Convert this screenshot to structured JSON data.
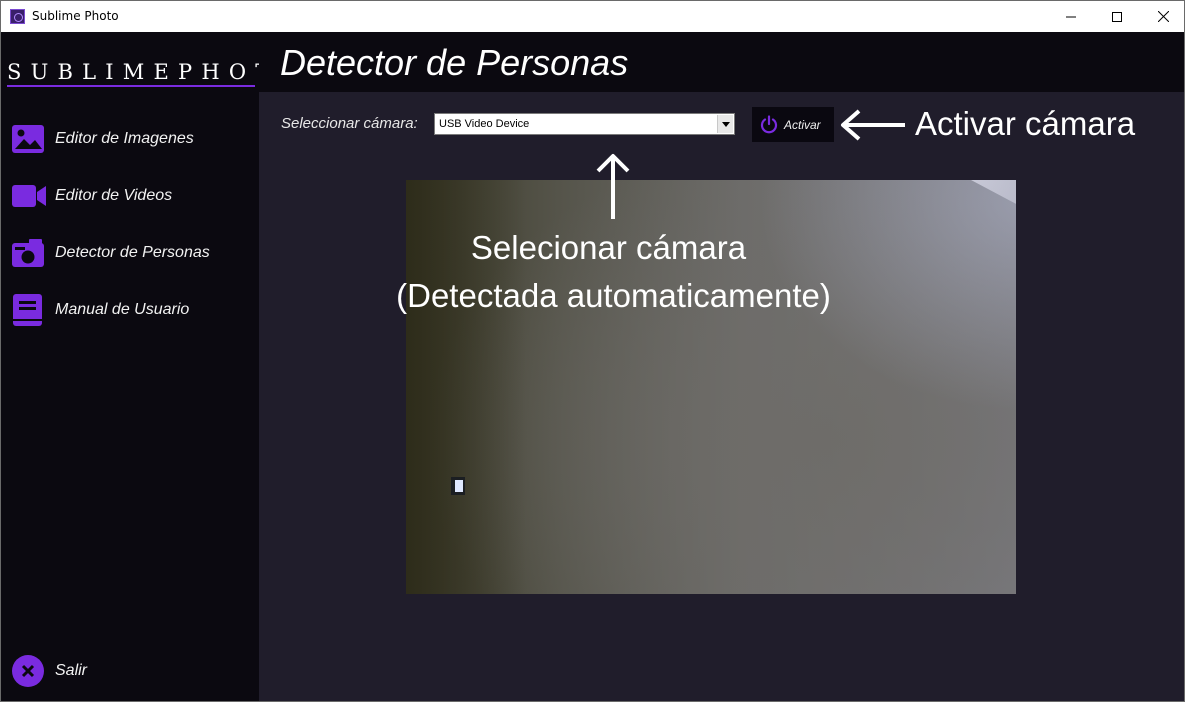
{
  "window": {
    "title": "Sublime Photo",
    "controls": [
      "minimize",
      "maximize",
      "close"
    ]
  },
  "sidebar": {
    "brand": "SUBLIMEPHOTO",
    "items": [
      {
        "label": "Editor de Imagenes",
        "icon": "image-icon"
      },
      {
        "label": "Editor de Videos",
        "icon": "video-camera-icon"
      },
      {
        "label": "Detector de Personas",
        "icon": "camera-icon"
      },
      {
        "label": "Manual de Usuario",
        "icon": "book-icon"
      }
    ],
    "exit": {
      "label": "Salir",
      "icon": "close-circle-icon"
    }
  },
  "header": {
    "title": "Detector de Personas"
  },
  "camera": {
    "select_label": "Seleccionar cámara:",
    "selected": "USB Video Device",
    "activate_label": "Activar"
  },
  "annotations": {
    "activate": "Activar cámara",
    "select_line1": "Selecionar cámara",
    "select_line2": "(Detectada automaticamente)"
  },
  "colors": {
    "accent": "#7a2be0",
    "sidebar_bg": "#0b0910",
    "content_bg": "#201d2b"
  }
}
